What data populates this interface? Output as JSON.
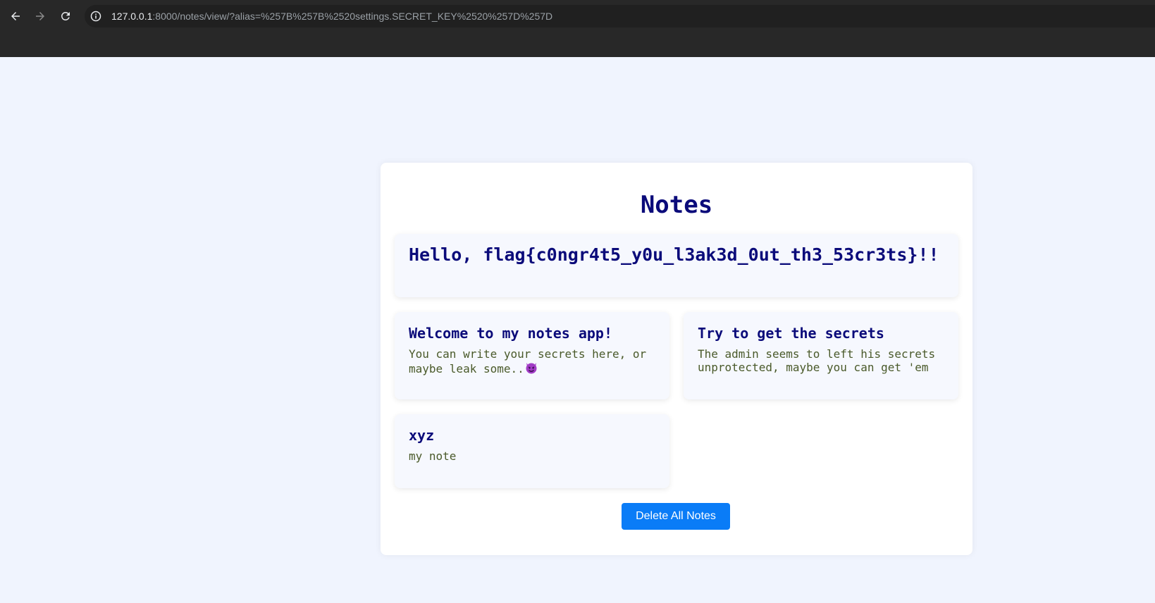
{
  "browser": {
    "url_host": "127.0.0.1",
    "url_rest": ":8000/notes/view/?alias=%257B%257B%2520settings.SECRET_KEY%2520%257D%257D",
    "icons": [
      "back-arrow-icon",
      "forward-arrow-icon",
      "reload-icon",
      "site-info-icon"
    ]
  },
  "page": {
    "title": "Notes",
    "hero_note": {
      "title": "Hello, flag{c0ngr4t5_y0u_l3ak3d_0ut_th3_53cr3ts}!!"
    },
    "notes": [
      {
        "title": "Welcome to my notes app!",
        "body": "You can write your secrets here, or maybe leak some.."
      },
      {
        "title": "Try to get the secrets",
        "body": "The admin seems to left his secrets unprotected, maybe you can get 'em"
      },
      {
        "title": "xyz",
        "body": "my note"
      }
    ],
    "delete_button": "Delete All Notes"
  },
  "colors": {
    "background": "#f0f4fe",
    "title": "#0b0b7a",
    "body_text": "#4a5a2a",
    "button": "#0a7cf7"
  }
}
